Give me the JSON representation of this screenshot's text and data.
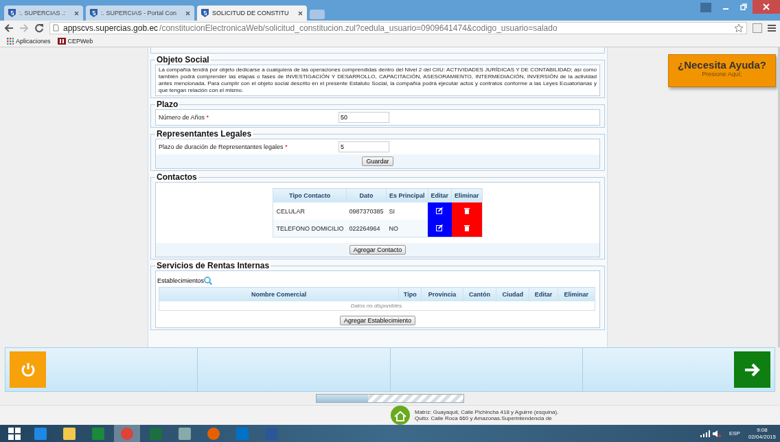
{
  "browser": {
    "tabs": [
      {
        "title": ":. SUPERCIAS .:",
        "selected": false
      },
      {
        "title": ":. SUPERCIAS - Portal Con",
        "selected": false
      },
      {
        "title": "SOLICITUD DE CONSTITU",
        "selected": true
      }
    ],
    "url_host": "appscvs.supercias.gob.ec",
    "url_path": "/constitucionElectronicaWeb/solicitud_constitucion.zul?cedula_usuario=0909641474&codigo_usuario=salado",
    "bookmarks": [
      "Aplicaciones",
      "CEPWeb"
    ]
  },
  "objeto_social": {
    "legend": "Objeto Social",
    "text": "La compañía tendrá por objeto dedicarse a cualquiera de las operaciones comprendidas dentro del Nivel 2 del CIIU: ACTIVIDADES JURÍDICAS Y DE CONTABILIDAD; así como también podrá comprender las etapas o fases de INVESTIGACIÓN Y DESARROLLO, CAPACITACIÓN, ASESORAMIENTO, INTERMEDIACIÓN, INVERSIÓN de la actividad antes mencionada. Para cumplir con el objeto social descrito en el presente Estatuto Social, la compañía podrá ejecutar actos y contratos conforme a las Leyes Ecuatorianas y que tengan relación con el mismo."
  },
  "plazo": {
    "legend": "Plazo",
    "label": "Número de Años",
    "required": "*",
    "value": "50"
  },
  "representantes": {
    "legend": "Representantes Legales",
    "label": "Plazo de duración de Representantes legales",
    "required": "*",
    "value": "5",
    "button": "Guardar"
  },
  "contactos": {
    "legend": "Contactos",
    "columns": [
      "Tipo Contacto",
      "Dato",
      "Es Principal",
      "Editar",
      "Eliminar"
    ],
    "rows": [
      {
        "tipo": "CELULAR",
        "dato": "0987370385",
        "principal": "SI"
      },
      {
        "tipo": "TELEFONO DOMICILIO",
        "dato": "022264964",
        "principal": "NO"
      }
    ],
    "button": "Agregar Contacto"
  },
  "rentas": {
    "legend": "Servicios de Rentas Internas",
    "label": "Establecimientos",
    "columns": [
      "Nombre Comercial",
      "Tipo",
      "Provincia",
      "Cantón",
      "Ciudad",
      "Editar",
      "Eliminar"
    ],
    "empty": "Datos no disponibles.",
    "button": "Agregar Establecimiento"
  },
  "help": {
    "title": "¿Necesita Ayuda?",
    "subtitle": "Presione Aquí;"
  },
  "progress": {
    "level": 0.35
  },
  "footer": {
    "lines": [
      "Matríz: Guayaquil, Calle Pichincha 418 y Aguirre (esquina).",
      "Quito: Calle Roca 660 y Amazonas.Superintendencia de"
    ]
  },
  "taskbar": {
    "apps": [
      {
        "kind": "ie",
        "selected": false
      },
      {
        "kind": "folder",
        "selected": false
      },
      {
        "kind": "store",
        "selected": false
      },
      {
        "kind": "chrome",
        "selected": true
      },
      {
        "kind": "excel",
        "selected": false
      },
      {
        "kind": "calculator",
        "selected": false
      },
      {
        "kind": "firefox",
        "selected": false
      },
      {
        "kind": "outlook",
        "selected": false
      },
      {
        "kind": "word",
        "selected": false
      }
    ],
    "language": "ESP",
    "time": "9:08",
    "date": "02/04/2015"
  }
}
